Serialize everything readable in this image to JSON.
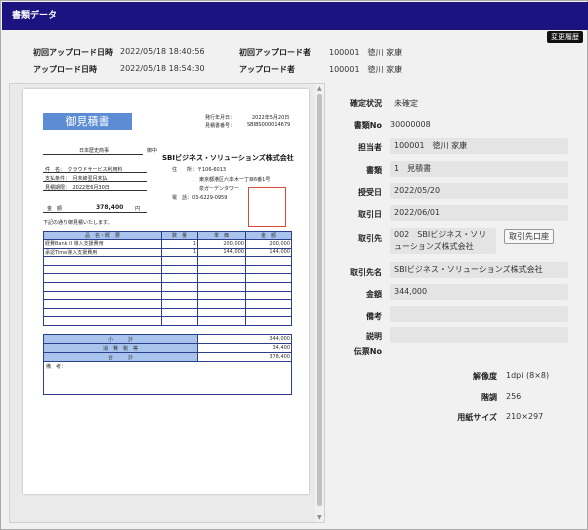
{
  "window": {
    "title": "書類データ",
    "history_button": "変更履歴"
  },
  "meta": {
    "first_upload_date_label": "初回アップロード日時",
    "first_upload_date": "2022/05/18 18:40:56",
    "first_uploader_label": "初回アップロード者",
    "first_uploader": "100001　徳川 家康",
    "upload_date_label": "アップロード日時",
    "upload_date": "2022/05/18 18:54:30",
    "uploader_label": "アップロード者",
    "uploader": "100001　徳川 家康"
  },
  "fields": {
    "status_label": "確定状況",
    "status": "未確定",
    "docno_label": "書類No",
    "docno": "30000008",
    "person_label": "担当者",
    "person": "100001　徳川 家康",
    "doc_label": "書類",
    "doc": "1　見積書",
    "received_label": "授受日",
    "received": "2022/05/20",
    "trade_label": "取引日",
    "trade": "2022/06/01",
    "partner_label": "取引先",
    "partner": "002　SBIビジネス・ソリューションズ株式会社",
    "partner_button": "取引先口座",
    "partner_name_label": "取引先名",
    "partner_name": "SBIビジネス・ソリューションズ株式会社",
    "amount_label": "金額",
    "amount": "344,000",
    "remarks_label": "備考",
    "remarks": "",
    "desc_label": "説明",
    "desc": "",
    "voucher_label": "伝票No",
    "resolution_label": "解像度",
    "resolution": "1dpi (8×8)",
    "gradation_label": "階調",
    "gradation": "256",
    "papersize_label": "用紙サイズ",
    "papersize": "210×297"
  },
  "document": {
    "title": "御見積書",
    "issue_date_label": "発行年月日：",
    "issue_date": "2022年5月20日",
    "quote_no_label": "見積書番号：",
    "quote_no": "SBIBS000014679",
    "client": "日本歴史商事",
    "honorific": "御中",
    "company": "SBIビジネス・ソリューションズ株式会社",
    "subject": "件　名：　クラウドサービス利用料",
    "payment": "支払条件：　月末締翌月末払",
    "expiry": "見積期限：　2022年6月30日",
    "addr_zip": "住　　所：〒106-6013",
    "addr1": "東京都港区六本木一丁目6番1号",
    "addr2": "泉ガーデンタワー",
    "tel": "電　話：03-6229-0959",
    "amount_label": "金　額",
    "amount": "378,400",
    "yen": "円",
    "intro": "下記の通り御見積いたします。",
    "headers": [
      "品　名・概　要",
      "数　量",
      "単　価",
      "金　額"
    ],
    "items": [
      {
        "name": "経費Bank II 導入支援費用",
        "qty": "1",
        "price": "200,000",
        "total": "200,000"
      },
      {
        "name": "承認Time導入支援費用",
        "qty": "1",
        "price": "144,000",
        "total": "144,000"
      }
    ],
    "subtotal_label": "小　　　計",
    "subtotal": "344,000",
    "tax_label": "消　費　税　等",
    "tax": "34,400",
    "total_label": "合　　　計",
    "total": "378,400",
    "memo_label": "備　考：",
    "stamp_text": "ビジネス・ソリューションズ株式会社之印"
  }
}
